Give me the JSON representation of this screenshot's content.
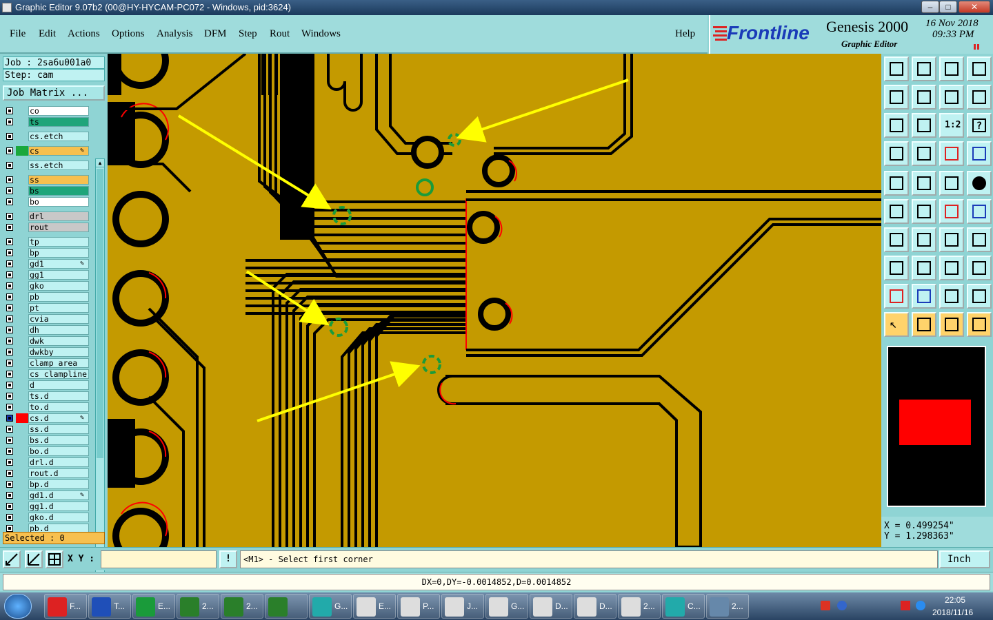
{
  "window": {
    "title": "Graphic Editor 9.07b2 (00@HY-HYCAM-PC072 - Windows, pid:3624)"
  },
  "menu": {
    "items": [
      "File",
      "Edit",
      "Actions",
      "Options",
      "Analysis",
      "DFM",
      "Step",
      "Rout",
      "Windows"
    ],
    "help": "Help"
  },
  "brand": {
    "logo": "Frontline",
    "product": "Genesis 2000",
    "subtitle": "Graphic Editor",
    "date": "16 Nov 2018",
    "time": "09:33 PM"
  },
  "job": {
    "job_label": "Job : 2sa6u001a0",
    "step_label": "Step: cam",
    "matrix_button": "Job Matrix ..."
  },
  "layers": [
    {
      "name": "co",
      "color": "#ffffff"
    },
    {
      "name": "ts",
      "color": "#1fa57a"
    },
    {
      "name": "cs.etch",
      "color": "#bff2f2"
    },
    {
      "name": "cs",
      "color": "#f7c04f",
      "swatch": "#1aa83c",
      "edit": true
    },
    {
      "name": "ss.etch",
      "color": "#bff2f2"
    },
    {
      "name": "ss",
      "color": "#f7c04f"
    },
    {
      "name": "bs",
      "color": "#1fa57a"
    },
    {
      "name": "bo",
      "color": "#ffffff"
    },
    {
      "name": "drl",
      "color": "#c8c8c8"
    },
    {
      "name": "rout",
      "color": "#c8c8c8"
    },
    {
      "name": "tp",
      "color": "#bff2f2"
    },
    {
      "name": "bp",
      "color": "#bff2f2"
    },
    {
      "name": "gd1",
      "color": "#bff2f2",
      "edit": true
    },
    {
      "name": "gg1",
      "color": "#bff2f2"
    },
    {
      "name": "gko",
      "color": "#bff2f2"
    },
    {
      "name": "pb",
      "color": "#bff2f2"
    },
    {
      "name": "pt",
      "color": "#bff2f2"
    },
    {
      "name": "cvia",
      "color": "#bff2f2"
    },
    {
      "name": "dh",
      "color": "#bff2f2"
    },
    {
      "name": "dwk",
      "color": "#bff2f2"
    },
    {
      "name": "dwkby",
      "color": "#bff2f2"
    },
    {
      "name": "clamp_area",
      "color": "#bff2f2"
    },
    {
      "name": "cs_clampline",
      "color": "#bff2f2"
    },
    {
      "name": "d",
      "color": "#bff2f2"
    },
    {
      "name": "ts.d",
      "color": "#bff2f2"
    },
    {
      "name": "to.d",
      "color": "#bff2f2"
    },
    {
      "name": "cs.d",
      "color": "#bff2f2",
      "swatch": "#ff0000",
      "edit": true,
      "active": true
    },
    {
      "name": "ss.d",
      "color": "#bff2f2"
    },
    {
      "name": "bs.d",
      "color": "#bff2f2"
    },
    {
      "name": "bo.d",
      "color": "#bff2f2"
    },
    {
      "name": "drl.d",
      "color": "#bff2f2"
    },
    {
      "name": "rout.d",
      "color": "#bff2f2"
    },
    {
      "name": "bp.d",
      "color": "#bff2f2"
    },
    {
      "name": "gd1.d",
      "color": "#bff2f2",
      "edit": true
    },
    {
      "name": "gg1.d",
      "color": "#bff2f2"
    },
    {
      "name": "gko.d",
      "color": "#bff2f2"
    },
    {
      "name": "pb.d",
      "color": "#bff2f2"
    }
  ],
  "selected": "Selected : 0",
  "coords": {
    "x": "X = 0.499254\"",
    "y": "Y = 1.298363\""
  },
  "toolbar": {
    "ratio_label": "1:2"
  },
  "bottom": {
    "xy_label": "X Y :",
    "xy_value": "",
    "message": "<M1> - Select first corner",
    "unit": "Inch",
    "delta": "DX=0,DY=-0.0014852,D=0.0014852"
  },
  "taskbar": {
    "items": [
      {
        "label": "F...",
        "color": "#d22"
      },
      {
        "label": "T...",
        "color": "#1f4fb8"
      },
      {
        "label": "E...",
        "color": "#1a9b3a"
      },
      {
        "label": "2...",
        "color": "#2a7f2a"
      },
      {
        "label": "2...",
        "color": "#2a7f2a"
      },
      {
        "label": "",
        "color": "#2a7f2a"
      },
      {
        "label": "G...",
        "color": "#2aa"
      },
      {
        "label": "E...",
        "color": "#ddd"
      },
      {
        "label": "P...",
        "color": "#ddd"
      },
      {
        "label": "J...",
        "color": "#ddd"
      },
      {
        "label": "G...",
        "color": "#ddd"
      },
      {
        "label": "D...",
        "color": "#ddd"
      },
      {
        "label": "D...",
        "color": "#ddd"
      },
      {
        "label": "2...",
        "color": "#ddd"
      },
      {
        "label": "C...",
        "color": "#2aa"
      },
      {
        "label": "2...",
        "color": "#68a"
      }
    ],
    "time": "22:05",
    "date": "2018/11/16"
  },
  "colors": {
    "board": "#c49a00",
    "trace_gap": "#000000",
    "arrow": "#ffff00",
    "highlight": "#1a9b3a"
  }
}
